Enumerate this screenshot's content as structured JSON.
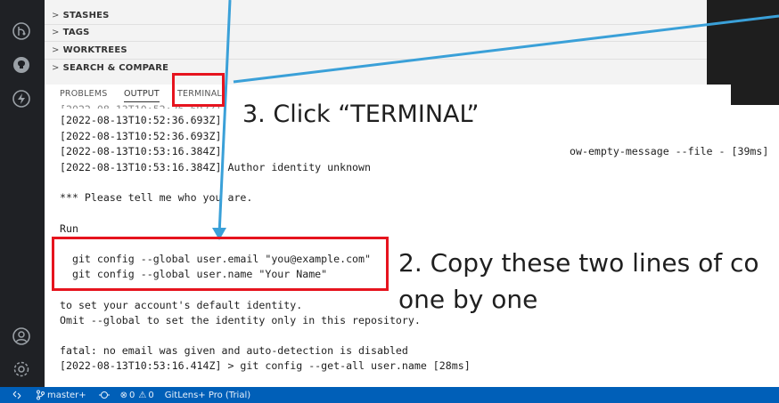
{
  "sidebar": {
    "sections": [
      {
        "chevron": ">",
        "label": "STASHES"
      },
      {
        "chevron": ">",
        "label": "TAGS"
      },
      {
        "chevron": ">",
        "label": "WORKTREES"
      },
      {
        "chevron": ">",
        "label": "SEARCH & COMPARE"
      }
    ]
  },
  "panel": {
    "tabs": [
      {
        "label": "PROBLEMS"
      },
      {
        "label": "OUTPUT"
      },
      {
        "label": "TERMINAL"
      }
    ]
  },
  "output": {
    "lines": [
      "[2022-08-13T10:52:36.693Z]",
      "[2022-08-13T10:52:36.693Z]",
      "[2022-08-13T10:53:16.384Z]",
      "[2022-08-13T10:53:16.384Z] Author identity unknown",
      "*** Please tell me who you are.",
      "Run",
      "  git config --global user.email \"you@example.com\"",
      "  git config --global user.name \"Your Name\"",
      "to set your account's default identity.",
      "Omit --global to set the identity only in this repository.",
      "fatal: no email was given and auto-detection is disabled",
      "[2022-08-13T10:53:16.414Z] > git config --get-all user.name [28ms]"
    ],
    "line3_suffix": "ow-empty-message --file - [39ms]"
  },
  "annotations": {
    "step3": "3. Click “TERMINAL”",
    "step2_line1": "2. Copy these two lines of co",
    "step2_line2": "one by one",
    "colors": {
      "highlight": "#e6141e",
      "arrow": "#3aa0d8"
    }
  },
  "statusbar": {
    "branch": "master+",
    "errors": "0",
    "warnings": "0",
    "gitlens": "GitLens+ Pro (Trial)"
  }
}
